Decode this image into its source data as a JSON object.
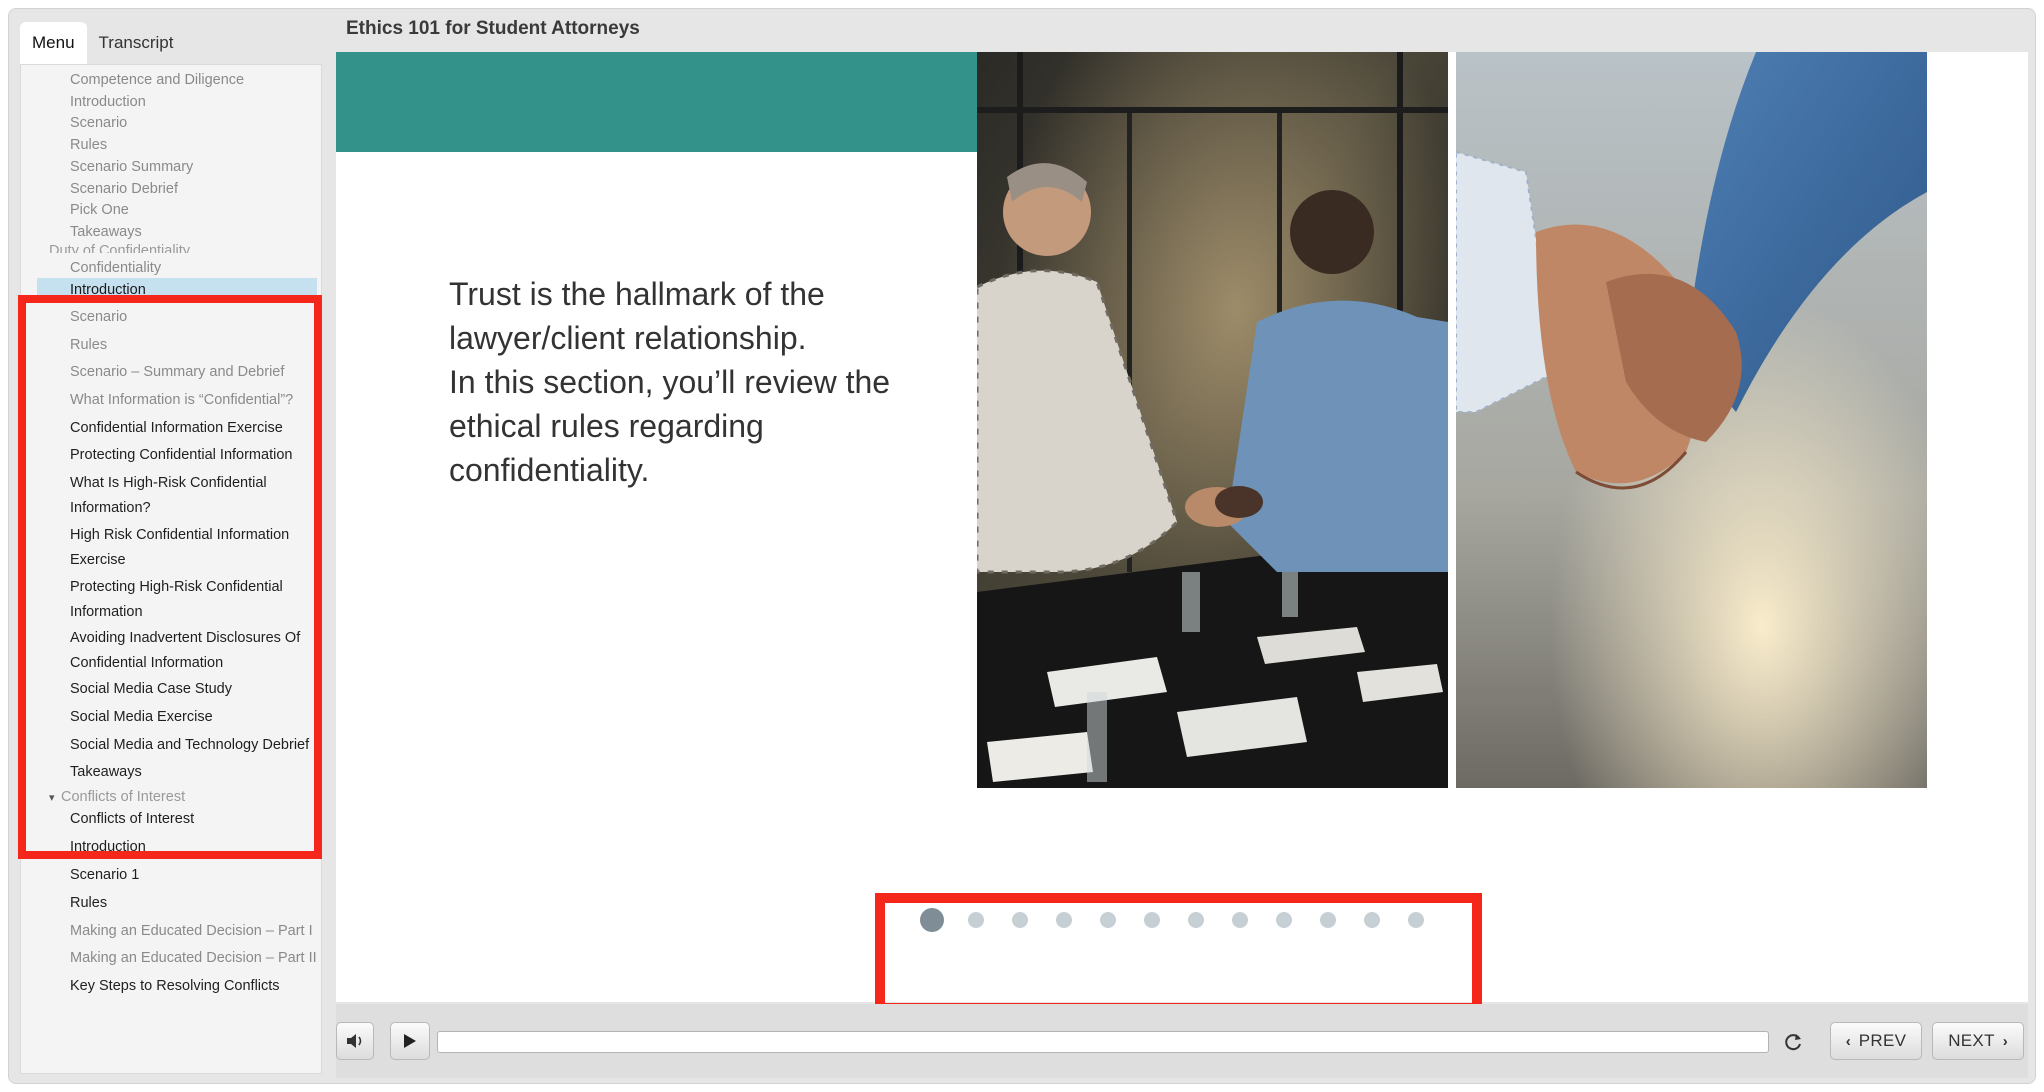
{
  "course_title": "Ethics 101 for Student Attorneys",
  "tabs": [
    {
      "label": "Menu",
      "active": true
    },
    {
      "label": "Transcript",
      "active": false
    }
  ],
  "menu": {
    "items": [
      {
        "label": "Competence and Diligence"
      },
      {
        "label": "Introduction"
      },
      {
        "label": "Scenario"
      },
      {
        "label": "Rules"
      },
      {
        "label": "Scenario Summary"
      },
      {
        "label": "Scenario Debrief"
      },
      {
        "label": "Pick One"
      },
      {
        "label": "Takeaways"
      },
      {
        "label": "Confidentiality"
      },
      {
        "label": "Introduction",
        "current": true
      },
      {
        "label": "Scenario"
      },
      {
        "label": "Rules"
      },
      {
        "label": "Scenario – Summary and Debrief"
      },
      {
        "label": "What Information is “Confidential”?"
      },
      {
        "label": "Confidential Information Exercise"
      },
      {
        "label": "Protecting Confidential Information"
      },
      {
        "label": "What Is High-Risk Confidential Information?"
      },
      {
        "label": "High Risk Confidential Information Exercise"
      },
      {
        "label": "Protecting High-Risk Confidential Information"
      },
      {
        "label": "Avoiding Inadvertent Disclosures Of Confidential Information"
      },
      {
        "label": "Social Media Case Study"
      },
      {
        "label": "Social Media Exercise"
      },
      {
        "label": "Social Media and Technology Debrief"
      },
      {
        "label": "Takeaways"
      },
      {
        "label": "Conflicts of Interest"
      },
      {
        "label": "Introduction"
      },
      {
        "label": "Scenario 1"
      },
      {
        "label": "Rules"
      },
      {
        "label": "Making an Educated Decision – Part I"
      },
      {
        "label": "Making an Educated Decision – Part II"
      },
      {
        "label": "Key Steps to Resolving Conflicts"
      }
    ],
    "sections": [
      {
        "label": "Duty of Confidentiality"
      },
      {
        "label": "Conflicts of Interest",
        "expanded": true
      }
    ]
  },
  "slide": {
    "lines": [
      "Trust is the hallmark of the",
      "lawyer/client relationship.",
      "In this section, you’ll review the",
      "ethical rules regarding",
      "confidentiality."
    ],
    "dots_count": 12,
    "active_dot": 1
  },
  "player": {
    "prev_label": "PREV",
    "next_label": "NEXT",
    "progress": 0
  },
  "colors": {
    "accent_teal": "#339289",
    "highlight_red": "#f4271a",
    "active_menu_bg": "#c5e1f0"
  }
}
